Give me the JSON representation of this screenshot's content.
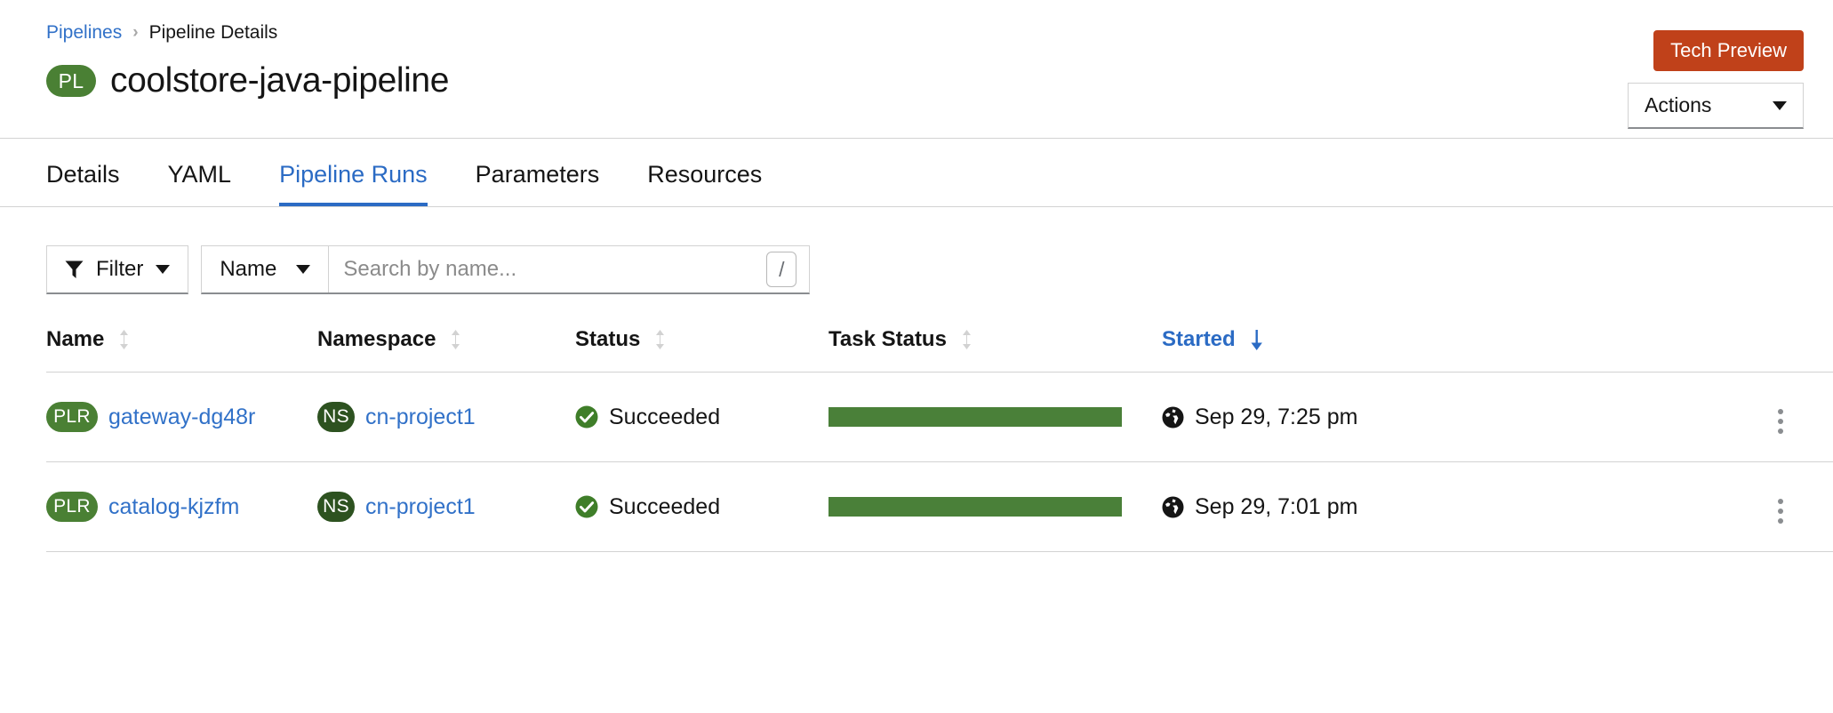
{
  "breadcrumb": {
    "parent": "Pipelines",
    "separator": "›",
    "current": "Pipeline Details"
  },
  "header": {
    "badge": "PL",
    "badge_icon": "pipeline-resource-badge",
    "title": "coolstore-java-pipeline",
    "tech_preview_label": "Tech Preview",
    "actions_label": "Actions",
    "caret_icon": "chevron-down-icon",
    "accent_orange": "#c0411a",
    "accent_green": "#4a8034",
    "link_blue": "#3171c8"
  },
  "tabs": [
    {
      "label": "Details",
      "active": false
    },
    {
      "label": "YAML",
      "active": false
    },
    {
      "label": "Pipeline Runs",
      "active": true
    },
    {
      "label": "Parameters",
      "active": false
    },
    {
      "label": "Resources",
      "active": false
    }
  ],
  "toolbar": {
    "filter_label": "Filter",
    "filter_icon": "funnel-icon",
    "filter_caret_icon": "chevron-down-icon",
    "search_type_label": "Name",
    "search_type_caret_icon": "chevron-down-icon",
    "search_placeholder": "Search by name...",
    "search_value": "",
    "shortcut_key": "/"
  },
  "table": {
    "columns": [
      {
        "label": "Name",
        "sort": "none",
        "sort_icon": "sort-both-icon"
      },
      {
        "label": "Namespace",
        "sort": "none",
        "sort_icon": "sort-both-icon"
      },
      {
        "label": "Status",
        "sort": "none",
        "sort_icon": "sort-both-icon"
      },
      {
        "label": "Task Status",
        "sort": "none",
        "sort_icon": "sort-both-icon"
      },
      {
        "label": "Started",
        "sort": "descending",
        "sort_icon": "sort-down-icon"
      }
    ],
    "rows": [
      {
        "name_badge": "PLR",
        "name": "gateway-dg48r",
        "namespace_badge": "NS",
        "namespace": "cn-project1",
        "status": "Succeeded",
        "status_icon": "check-circle-icon",
        "task_status_percent": 100,
        "task_status_color": "#4a8039",
        "started": "Sep 29, 7:25 pm",
        "started_icon": "globe-icon",
        "row_menu_icon": "kebab-menu-icon"
      },
      {
        "name_badge": "PLR",
        "name": "catalog-kjzfm",
        "namespace_badge": "NS",
        "namespace": "cn-project1",
        "status": "Succeeded",
        "status_icon": "check-circle-icon",
        "task_status_percent": 100,
        "task_status_color": "#4a8039",
        "started": "Sep 29, 7:01 pm",
        "started_icon": "globe-icon",
        "row_menu_icon": "kebab-menu-icon"
      }
    ]
  }
}
